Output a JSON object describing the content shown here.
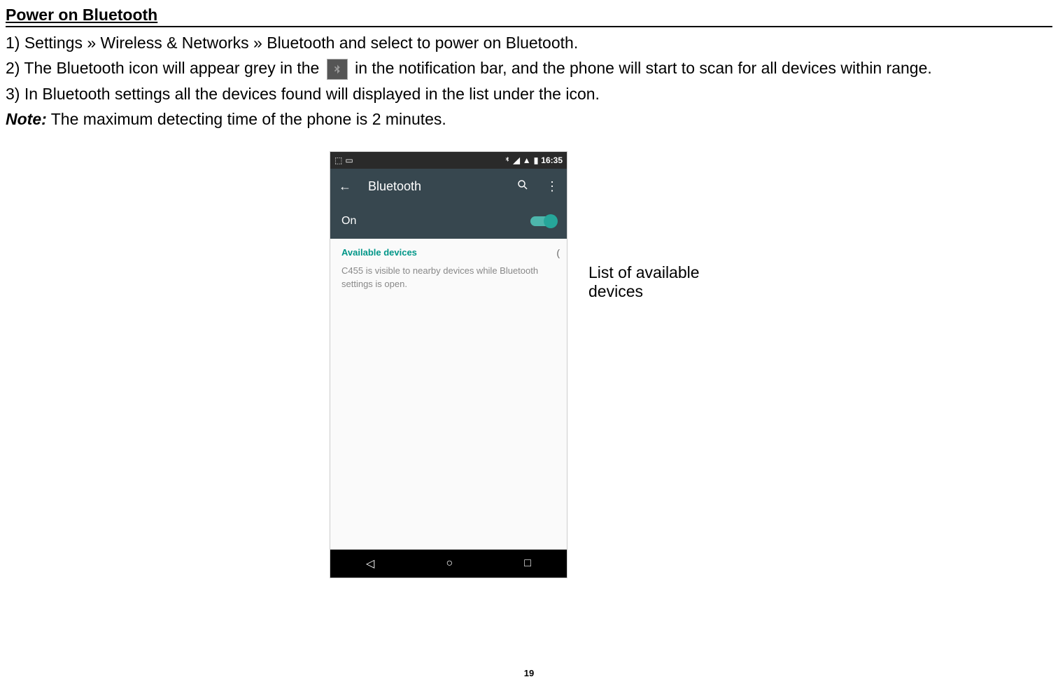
{
  "heading": "Power on Bluetooth",
  "step1": "1) Settings » Wireless & Networks » Bluetooth and select to power on Bluetooth.",
  "step2_part1": "2) The Bluetooth icon will appear grey in the ",
  "step2_part2": " in the notification bar, and the phone will start to scan for all devices within range.",
  "step3": "3) In Bluetooth settings all the devices found will displayed in the list under the icon.",
  "note_label": "Note:",
  "note_text": " The maximum detecting time of the phone is 2 minutes.",
  "callout": "List of available devices",
  "page_number": "19",
  "screenshot": {
    "status_time": "16:35",
    "toolbar_title": "Bluetooth",
    "on_label": "On",
    "available_label": "Available devices",
    "info_text": "C455 is visible to nearby devices while Bluetooth settings is open."
  }
}
